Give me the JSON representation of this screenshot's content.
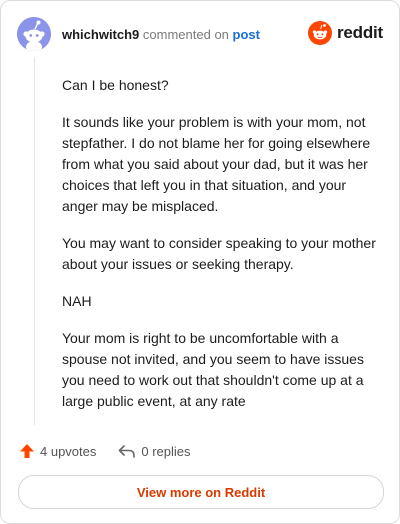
{
  "header": {
    "username": "whichwitch9",
    "action": "commented on",
    "post_link": "post"
  },
  "brand": {
    "name": "reddit"
  },
  "comment": {
    "paragraphs": [
      "Can I be honest?",
      "It sounds like your problem is with your mom, not stepfather. I do not blame her for going elsewhere from what you said about your dad, but it was her choices that left you in that situation, and your anger may be misplaced.",
      "You may want to consider speaking to your mother about your issues or seeking therapy.",
      "NAH",
      "Your mom is right to be uncomfortable with a spouse not invited, and you seem to have issues you need to work out that shouldn't come up at a large public event, at any rate"
    ]
  },
  "footer": {
    "upvotes": "4 upvotes",
    "replies": "0 replies"
  },
  "cta": {
    "label": "View more on Reddit"
  },
  "colors": {
    "accent": "#d93a00",
    "upvote": "#ff4500",
    "link": "#1a6fd1",
    "avatar": "#8b94e8"
  },
  "icons": [
    "snoo-avatar-icon",
    "reddit-logo-icon",
    "upvote-arrow-icon",
    "reply-arrow-icon"
  ]
}
